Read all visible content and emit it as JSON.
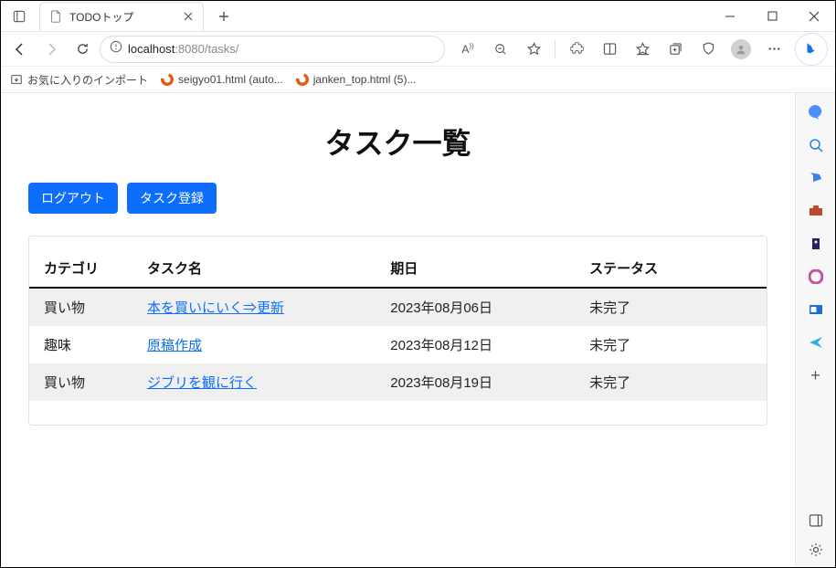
{
  "browser": {
    "tab_title": "TODOトップ",
    "url_host": "localhost",
    "url_rest": ":8080/tasks/",
    "bookmarks": [
      {
        "label": "お気に入りのインポート"
      },
      {
        "label": "seigyo01.html (auto..."
      },
      {
        "label": "janken_top.html (5)..."
      }
    ]
  },
  "page": {
    "title": "タスク一覧",
    "buttons": {
      "logout": "ログアウト",
      "register": "タスク登録"
    },
    "table": {
      "headers": {
        "category": "カテゴリ",
        "taskname": "タスク名",
        "due": "期日",
        "status": "ステータス"
      },
      "rows": [
        {
          "category": "買い物",
          "task": "本を買いにいく⇒更新",
          "due": "2023年08月06日",
          "status": "未完了"
        },
        {
          "category": "趣味",
          "task": "原稿作成",
          "due": "2023年08月12日",
          "status": "未完了"
        },
        {
          "category": "買い物",
          "task": "ジブリを観に行く",
          "due": "2023年08月19日",
          "status": "未完了"
        }
      ]
    }
  }
}
